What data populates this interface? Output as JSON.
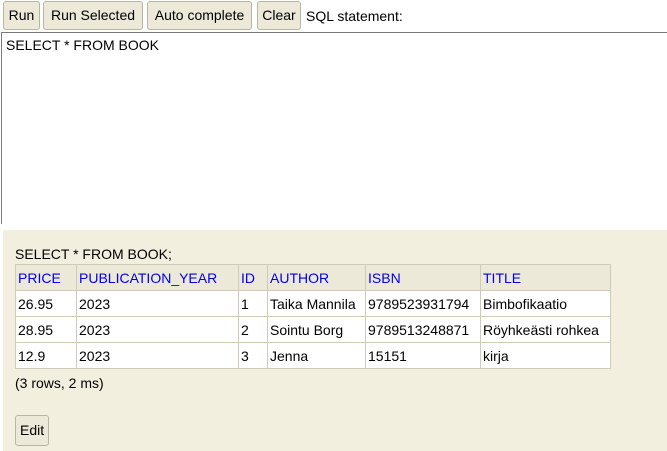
{
  "toolbar": {
    "run_label": "Run",
    "run_selected_label": "Run Selected",
    "auto_complete_label": "Auto complete",
    "clear_label": "Clear",
    "sql_statement_label": "SQL statement:"
  },
  "editor": {
    "value": "SELECT * FROM BOOK"
  },
  "results": {
    "query_text": "SELECT * FROM BOOK;",
    "columns": [
      "PRICE",
      "PUBLICATION_YEAR",
      "ID",
      "AUTHOR",
      "ISBN",
      "TITLE"
    ],
    "rows": [
      [
        "26.95",
        "2023",
        "1",
        "Taika Mannila",
        "9789523931794",
        "Bimbofikaatio"
      ],
      [
        "28.95",
        "2023",
        "2",
        "Sointu Borg",
        "9789513248871",
        "Röyhkeästi rohkea"
      ],
      [
        "12.9",
        "2023",
        "3",
        "Jenna",
        "15151",
        "kirja"
      ]
    ],
    "summary": "(3 rows, 2 ms)",
    "edit_label": "Edit"
  }
}
